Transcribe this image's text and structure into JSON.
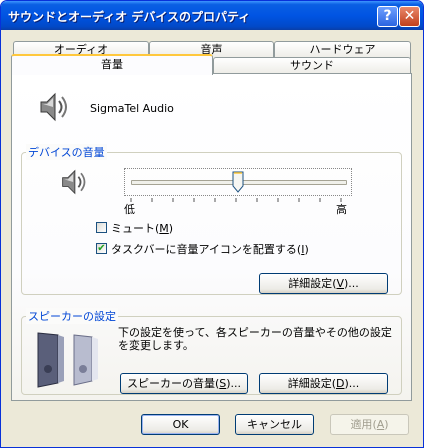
{
  "window": {
    "title": "サウンドとオーディオ デバイスのプロパティ"
  },
  "titlebar": {
    "help": "?",
    "close": "✕"
  },
  "tabs": {
    "row1": [
      "オーディオ",
      "音声",
      "ハードウェア"
    ],
    "row2": [
      "音量",
      "サウンド"
    ],
    "active": "音量"
  },
  "device": {
    "name": "SigmaTel Audio"
  },
  "device_volume": {
    "group_label": "デバイスの音量",
    "low_label": "低",
    "high_label": "高",
    "level": 0.5,
    "mute_label": "ミュート",
    "mute_key": "M",
    "mute_checked": false,
    "taskbar_label": "タスクバーに音量アイコンを配置する",
    "taskbar_key": "I",
    "taskbar_checked": true,
    "advanced_label": "詳細設定",
    "advanced_key": "V"
  },
  "speaker_settings": {
    "group_label": "スピーカーの設定",
    "description": "下の設定を使って、各スピーカーの音量やその他の設定を変更します。",
    "speaker_volume_label": "スピーカーの音量",
    "speaker_volume_key": "S",
    "advanced_label": "詳細設定",
    "advanced_key": "D"
  },
  "footer": {
    "ok": "OK",
    "cancel": "キャンセル",
    "apply_label": "適用",
    "apply_key": "A"
  }
}
